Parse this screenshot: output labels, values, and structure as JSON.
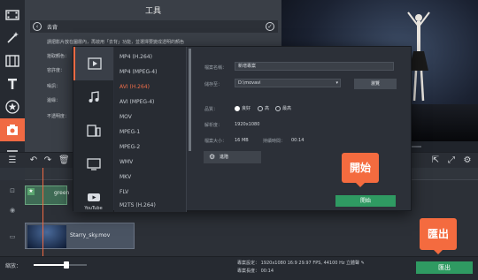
{
  "tools_panel": {
    "title": "工具",
    "subtitle": "去背",
    "rows": [
      "請把影片放在圖層內，再啟用「去背」功能，並選擇要變成透明的顏色",
      "拾取顏色：",
      "容許度：",
      "噪訊：",
      "邊緣：",
      "不透明度："
    ]
  },
  "dialog": {
    "categories": [
      {
        "name": "video-category",
        "label": ""
      },
      {
        "name": "audio-category",
        "label": ""
      },
      {
        "name": "device-category",
        "label": ""
      },
      {
        "name": "tv-category",
        "label": ""
      },
      {
        "name": "youtube-category",
        "label": "YouTube"
      }
    ],
    "formats": [
      "MP4 (H.264)",
      "MP4 (MPEG-4)",
      "AVI (H.264)",
      "AVI (MPEG-4)",
      "MOV",
      "MPEG-1",
      "MPEG-2",
      "WMV",
      "MKV",
      "FLV",
      "M2TS (H.264)"
    ],
    "selected_format": "AVI (H.264)",
    "settings": {
      "file_name_label": "檔案名稱：",
      "file_name_value": "新增專案",
      "save_to_label": "儲存至：",
      "save_to_value": "D:\\movavi",
      "browse_label": "瀏覽",
      "quality_label": "品質：",
      "quality_options": [
        "良好",
        "高",
        "最高"
      ],
      "quality_selected": "良好",
      "resolution_label": "解析度：",
      "resolution_value": "1920x1080",
      "file_size_label": "檔案大小：",
      "file_size_value": "16 MB",
      "duration_label": "持續時間：",
      "duration_value": "00:14",
      "advanced_label": "進階",
      "start_label": "開始"
    }
  },
  "timeline": {
    "clip_green_label": "green",
    "clip_video_label": "Starry_sky.mov"
  },
  "bottom": {
    "zoom_label": "縮放：",
    "zoom_level": 0.62,
    "project_settings_label": "專案設定：",
    "project_settings_value": "1920x1080 16:9 29.97 FPS, 44100 Hz 立體聲",
    "project_length_label": "專案長度：",
    "project_length_value": "00:14",
    "export_label": "匯出"
  },
  "callouts": {
    "start": "開始",
    "export": "匯出"
  },
  "colors": {
    "accent": "#f06a43",
    "green_button": "#2f9a62",
    "selected_format": "#ef6d4a"
  }
}
